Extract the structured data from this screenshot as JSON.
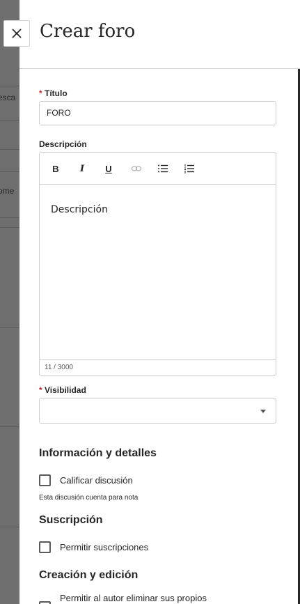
{
  "background": {
    "fragments": [
      "esca",
      "ome"
    ]
  },
  "panel": {
    "title": "Crear foro",
    "close_icon": "close-icon"
  },
  "form": {
    "title_field": {
      "required_marker": "*",
      "label": "Título",
      "value": "FORO"
    },
    "description": {
      "label": "Descripción",
      "toolbar": [
        {
          "name": "bold-button",
          "icon": "bold-icon",
          "glyph": "B"
        },
        {
          "name": "italic-button",
          "icon": "italic-icon",
          "glyph": "I"
        },
        {
          "name": "underline-button",
          "icon": "underline-icon",
          "glyph": "U"
        },
        {
          "name": "link-button",
          "icon": "link-icon"
        },
        {
          "name": "bulleted-list-button",
          "icon": "bulleted-list-icon"
        },
        {
          "name": "numbered-list-button",
          "icon": "numbered-list-icon"
        }
      ],
      "placeholder": "Descripción",
      "counter": "11 / 3000"
    },
    "visibility": {
      "required_marker": "*",
      "label": "Visibilidad",
      "value": ""
    }
  },
  "sections": {
    "info": {
      "title": "Información y detalles",
      "grade_checkbox": "Calificar discusión",
      "grade_helper": "Esta discusión cuenta para nota"
    },
    "subscription": {
      "title": "Suscripción",
      "allow_checkbox": "Permitir suscripciones"
    },
    "creation": {
      "title": "Creación y edición",
      "author_delete_checkbox": "Permitir al autor eliminar sus propios"
    }
  },
  "colors": {
    "required": "#c42e2e",
    "overlay": "#6f6f6f",
    "text": "#262626"
  }
}
